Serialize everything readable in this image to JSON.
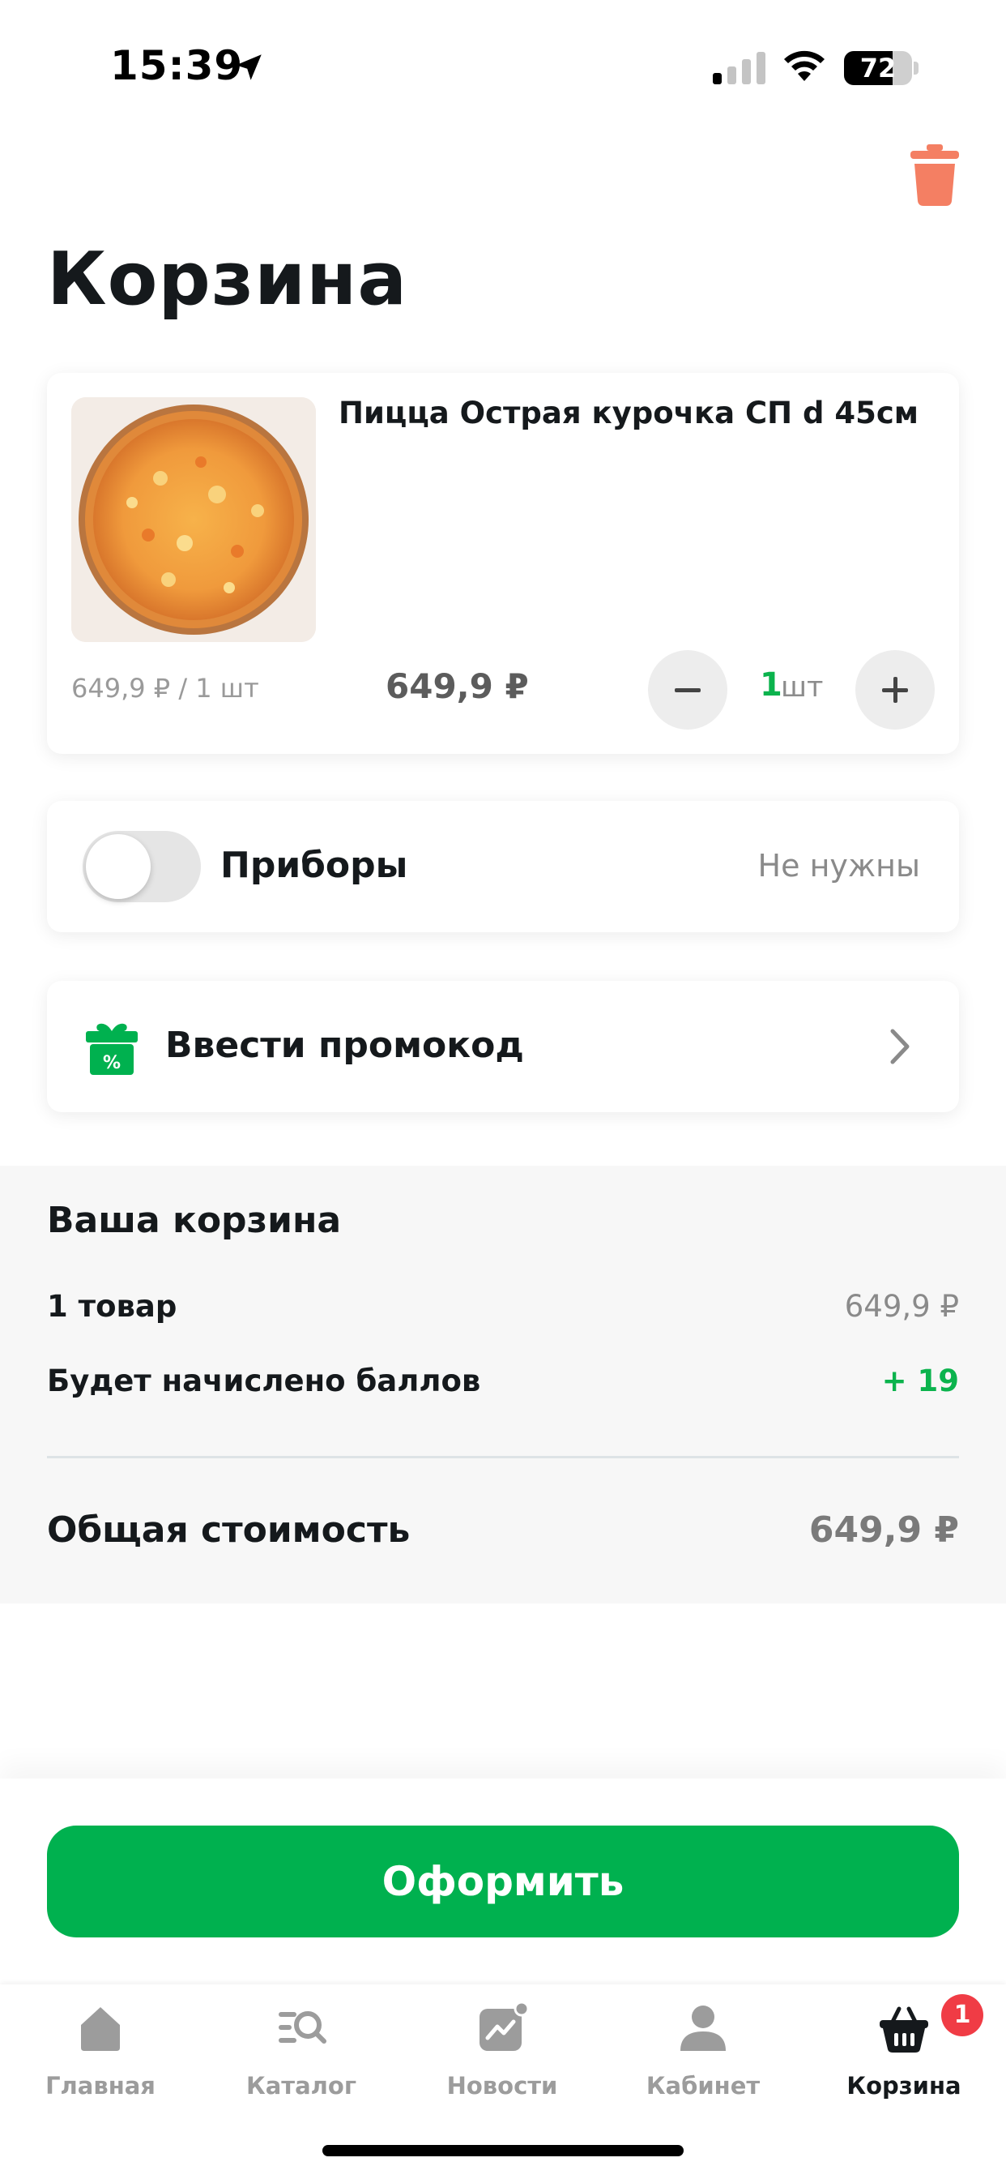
{
  "status_bar": {
    "time": "15:39",
    "battery_level": "72",
    "battery_fraction": 0.72
  },
  "page": {
    "title": "Корзина",
    "trash_icon": "trash-icon"
  },
  "cart_item": {
    "name": "Пицца Острая курочка  СП d 45см",
    "unit_price": "649,9 ₽ / 1 шт",
    "total_price": "649,9 ₽",
    "quantity": "1",
    "quantity_unit": "шт"
  },
  "cutlery": {
    "label": "Приборы",
    "status": "Не нужны",
    "enabled": false
  },
  "promo": {
    "label": "Ввести промокод",
    "icon": "gift-percent-icon"
  },
  "summary": {
    "title": "Ваша корзина",
    "items_label": "1 товар",
    "items_value": "649,9 ₽",
    "points_label": "Будет начислено баллов",
    "points_value": "+ 19",
    "total_label": "Общая стоимость",
    "total_value": "649,9 ₽"
  },
  "checkout": {
    "button_label": "Оформить"
  },
  "tab_bar": {
    "tabs": [
      {
        "label": "Главная",
        "icon": "home-icon"
      },
      {
        "label": "Каталог",
        "icon": "catalog-search-icon"
      },
      {
        "label": "Новости",
        "icon": "news-chart-icon"
      },
      {
        "label": "Кабинет",
        "icon": "user-icon"
      },
      {
        "label": "Корзина",
        "icon": "basket-icon",
        "active": true,
        "badge": "1"
      }
    ]
  },
  "colors": {
    "accent_green": "#00b14f",
    "trash_red": "#f47f63",
    "badge_red": "#f03c45",
    "text_dark": "#15191c"
  }
}
